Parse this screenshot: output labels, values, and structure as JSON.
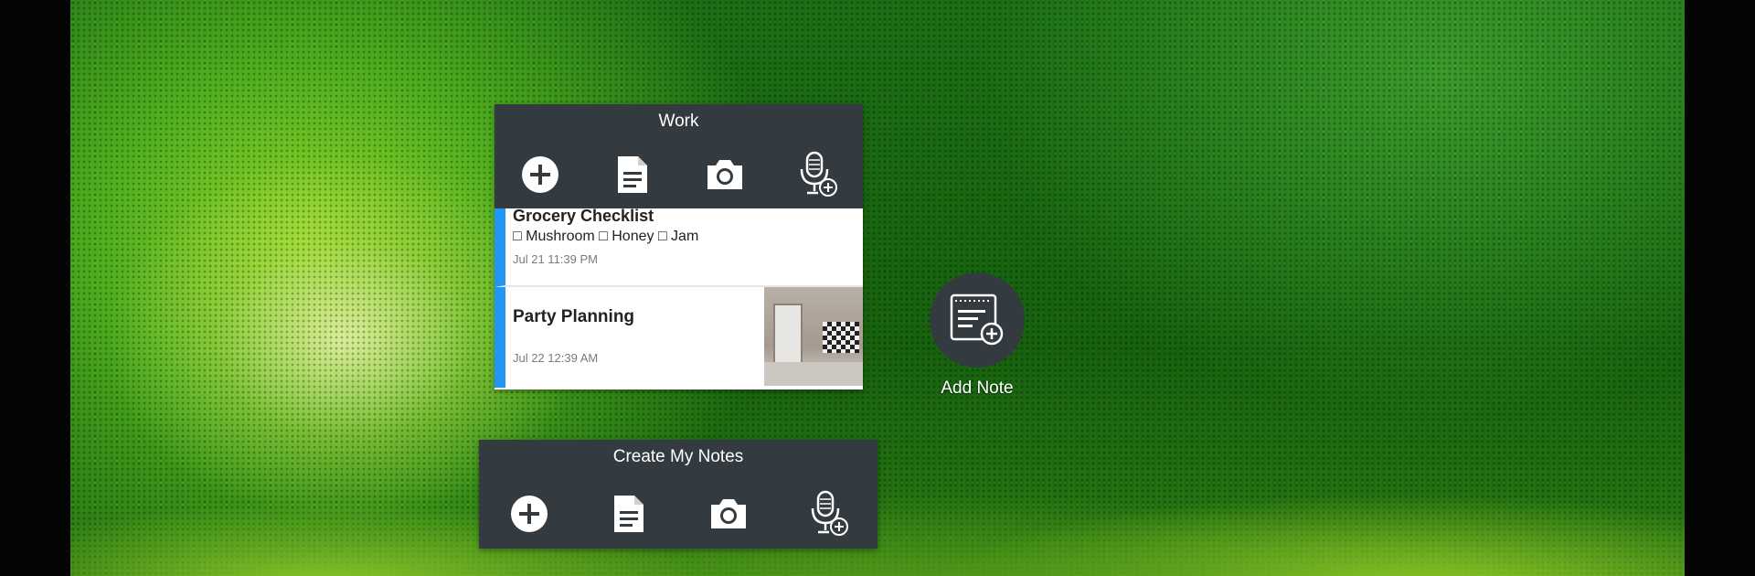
{
  "widgets": {
    "work": {
      "title": "Work",
      "actions": [
        {
          "icon": "plus-circle-icon"
        },
        {
          "icon": "document-icon"
        },
        {
          "icon": "camera-icon"
        },
        {
          "icon": "microphone-add-icon"
        }
      ],
      "notes": [
        {
          "title": "Grocery Checklist",
          "body": "□ Mushroom □ Honey □ Jam",
          "date": "Jul 21 11:39 PM",
          "accent": "#2196f3"
        },
        {
          "title": "Party Planning",
          "date": "Jul 22 12:39 AM",
          "accent": "#2196f3",
          "thumbnail": "room-photo"
        }
      ]
    },
    "create": {
      "title": "Create My Notes",
      "actions": [
        {
          "icon": "plus-circle-icon"
        },
        {
          "icon": "document-icon"
        },
        {
          "icon": "camera-icon"
        },
        {
          "icon": "microphone-add-icon"
        }
      ]
    }
  },
  "shortcut": {
    "label": "Add Note",
    "icon": "note-add-icon"
  },
  "colors": {
    "widget_bg": "#333b41",
    "note_accent": "#2196f3"
  }
}
